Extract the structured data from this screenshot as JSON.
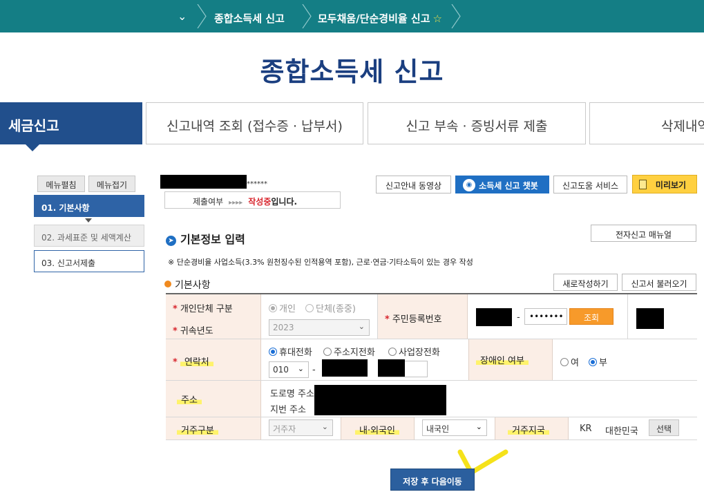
{
  "topbar": {
    "crumb1": "종합소득세 신고",
    "crumb2": "모두채움/단순경비율 신고",
    "favorite_icon": "star-outline-icon"
  },
  "page_title": "종합소득세 신고",
  "tabs": {
    "active": "세금신고",
    "items": [
      "신고내역 조회 (접수증 · 납부서)",
      "신고 부속 · 증빙서류 제출",
      "삭제내역"
    ]
  },
  "left_menu": {
    "expand": "메뉴펼침",
    "collapse": "메뉴접기",
    "items": [
      "01. 기본사항",
      "02. 과세표준 및 세액계산",
      "03. 신고서제출"
    ]
  },
  "user": {
    "masked_suffix": "******"
  },
  "status": {
    "label": "제출여부",
    "arrows": "▸▸▸▸",
    "value": "작성중",
    "suffix": "입니다."
  },
  "toolbar": {
    "video": "신고안내 동영상",
    "chatbot": "소득세 신고 챗봇",
    "help": "신고도움 서비스",
    "preview": "미리보기"
  },
  "section": {
    "title": "기본정보 입력",
    "manual_button": "전자신고 매뉴얼",
    "note": "※ 단순경비율 사업소득(3.3% 원천징수된 인적용역 포함), 근로·연금·기타소득이 있는 경우 작성",
    "sub_title": "기본사항",
    "new_button": "새로작성하기",
    "load_button": "신고서 불러오기"
  },
  "form": {
    "type_label": "개인단체 구분",
    "type_options": [
      "개인",
      "단체(종중)"
    ],
    "year_label": "귀속년도",
    "year_value": "2023",
    "rrn_label": "주민등록번호",
    "rrn_dash": "-",
    "rrn_masked": "•••••••",
    "lookup_button": "조회",
    "contact_label": "연락처",
    "phone_options": [
      "휴대전화",
      "주소지전화",
      "사업장전화"
    ],
    "phone_prefix": "010",
    "phone_dash": "-",
    "disability_label": "장애인 여부",
    "disability_options": [
      "여",
      "부"
    ],
    "address_label": "주소",
    "road_address_label": "도로명 주소",
    "lot_address_label": "지번 주소",
    "residence_label": "거주구분",
    "residence_value": "거주자",
    "nationality_label": "내·외국인",
    "nationality_value": "내국인",
    "country_label": "거주지국",
    "country_code": "KR",
    "country_name": "대한민국",
    "select_button": "선택"
  },
  "submit_button": "저장 후 다음이동",
  "colors": {
    "topbar": "#147e85",
    "title": "#1b3f80",
    "active_tab": "#214f8c",
    "highlight": "#fff36b",
    "label_bg": "#fbeee6"
  }
}
